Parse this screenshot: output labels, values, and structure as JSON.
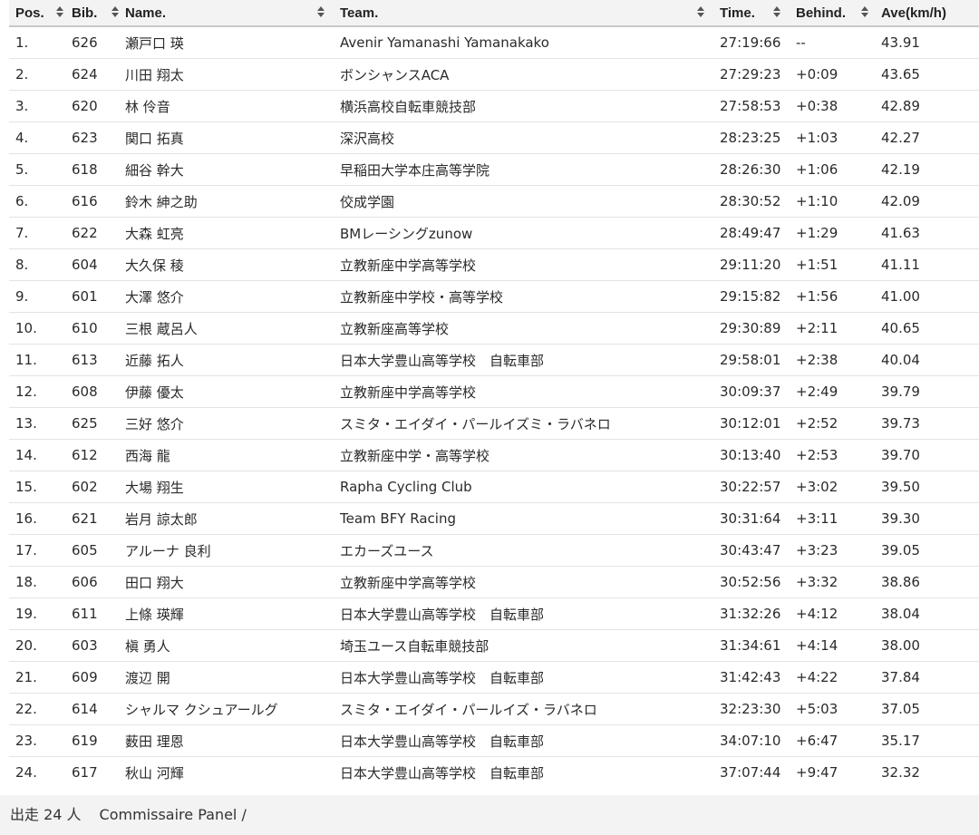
{
  "columns": [
    {
      "key": "pos",
      "label": "Pos."
    },
    {
      "key": "bib",
      "label": "Bib."
    },
    {
      "key": "name",
      "label": "Name."
    },
    {
      "key": "team",
      "label": "Team."
    },
    {
      "key": "time",
      "label": "Time."
    },
    {
      "key": "behind",
      "label": "Behind."
    },
    {
      "key": "ave",
      "label": "Ave(km/h)"
    }
  ],
  "rows": [
    {
      "pos": "1.",
      "bib": "626",
      "name": "瀬戸口 瑛",
      "team": "Avenir Yamanashi Yamanakako",
      "time": "27:19:66",
      "behind": "--",
      "ave": "43.91"
    },
    {
      "pos": "2.",
      "bib": "624",
      "name": "川田 翔太",
      "team": "ボンシャンスACA",
      "time": "27:29:23",
      "behind": "+0:09",
      "ave": "43.65"
    },
    {
      "pos": "3.",
      "bib": "620",
      "name": "林 伶音",
      "team": "横浜高校自転車競技部",
      "time": "27:58:53",
      "behind": "+0:38",
      "ave": "42.89"
    },
    {
      "pos": "4.",
      "bib": "623",
      "name": "関口 拓真",
      "team": "深沢高校",
      "time": "28:23:25",
      "behind": "+1:03",
      "ave": "42.27"
    },
    {
      "pos": "5.",
      "bib": "618",
      "name": "細谷 幹大",
      "team": "早稲田大学本庄高等学院",
      "time": "28:26:30",
      "behind": "+1:06",
      "ave": "42.19"
    },
    {
      "pos": "6.",
      "bib": "616",
      "name": "鈴木 紳之助",
      "team": "佼成学園",
      "time": "28:30:52",
      "behind": "+1:10",
      "ave": "42.09"
    },
    {
      "pos": "7.",
      "bib": "622",
      "name": "大森 虹亮",
      "team": "BMレーシングzunow",
      "time": "28:49:47",
      "behind": "+1:29",
      "ave": "41.63"
    },
    {
      "pos": "8.",
      "bib": "604",
      "name": "大久保 稜",
      "team": "立教新座中学高等学校",
      "time": "29:11:20",
      "behind": "+1:51",
      "ave": "41.11"
    },
    {
      "pos": "9.",
      "bib": "601",
      "name": "大澤 悠介",
      "team": "立教新座中学校・高等学校",
      "time": "29:15:82",
      "behind": "+1:56",
      "ave": "41.00"
    },
    {
      "pos": "10.",
      "bib": "610",
      "name": "三根 蔵呂人",
      "team": "立教新座高等学校",
      "time": "29:30:89",
      "behind": "+2:11",
      "ave": "40.65"
    },
    {
      "pos": "11.",
      "bib": "613",
      "name": "近藤 拓人",
      "team": "日本大学豊山高等学校　自転車部",
      "time": "29:58:01",
      "behind": "+2:38",
      "ave": "40.04"
    },
    {
      "pos": "12.",
      "bib": "608",
      "name": "伊藤 優太",
      "team": "立教新座中学高等学校",
      "time": "30:09:37",
      "behind": "+2:49",
      "ave": "39.79"
    },
    {
      "pos": "13.",
      "bib": "625",
      "name": "三好 悠介",
      "team": "スミタ・エイダイ・パールイズミ・ラバネロ",
      "time": "30:12:01",
      "behind": "+2:52",
      "ave": "39.73"
    },
    {
      "pos": "14.",
      "bib": "612",
      "name": "西海 龍",
      "team": "立教新座中学・高等学校",
      "time": "30:13:40",
      "behind": "+2:53",
      "ave": "39.70"
    },
    {
      "pos": "15.",
      "bib": "602",
      "name": "大場 翔生",
      "team": "Rapha Cycling Club",
      "time": "30:22:57",
      "behind": "+3:02",
      "ave": "39.50"
    },
    {
      "pos": "16.",
      "bib": "621",
      "name": "岩月 諒太郎",
      "team": "Team BFY Racing",
      "time": "30:31:64",
      "behind": "+3:11",
      "ave": "39.30"
    },
    {
      "pos": "17.",
      "bib": "605",
      "name": "アルーナ 良利",
      "team": "エカーズユース",
      "time": "30:43:47",
      "behind": "+3:23",
      "ave": "39.05"
    },
    {
      "pos": "18.",
      "bib": "606",
      "name": "田口 翔大",
      "team": "立教新座中学高等学校",
      "time": "30:52:56",
      "behind": "+3:32",
      "ave": "38.86"
    },
    {
      "pos": "19.",
      "bib": "611",
      "name": "上條 瑛輝",
      "team": "日本大学豊山高等学校　自転車部",
      "time": "31:32:26",
      "behind": "+4:12",
      "ave": "38.04"
    },
    {
      "pos": "20.",
      "bib": "603",
      "name": "槇 勇人",
      "team": "埼玉ユース自転車競技部",
      "time": "31:34:61",
      "behind": "+4:14",
      "ave": "38.00"
    },
    {
      "pos": "21.",
      "bib": "609",
      "name": "渡辺 開",
      "team": "日本大学豊山高等学校　自転車部",
      "time": "31:42:43",
      "behind": "+4:22",
      "ave": "37.84"
    },
    {
      "pos": "22.",
      "bib": "614",
      "name": "シャルマ クシュアールグ",
      "team": "スミタ・エイダイ・パールイズ・ラバネロ",
      "time": "32:23:30",
      "behind": "+5:03",
      "ave": "37.05"
    },
    {
      "pos": "23.",
      "bib": "619",
      "name": "薮田 理恩",
      "team": "日本大学豊山高等学校　自転車部",
      "time": "34:07:10",
      "behind": "+6:47",
      "ave": "35.17"
    },
    {
      "pos": "24.",
      "bib": "617",
      "name": "秋山 河輝",
      "team": "日本大学豊山高等学校　自転車部",
      "time": "37:07:44",
      "behind": "+9:47",
      "ave": "32.32"
    }
  ],
  "footer": {
    "entrants": "出走 24 人",
    "commissaire": "Commissaire Panel /"
  },
  "icons": {
    "sort": "sort-both-icon"
  }
}
